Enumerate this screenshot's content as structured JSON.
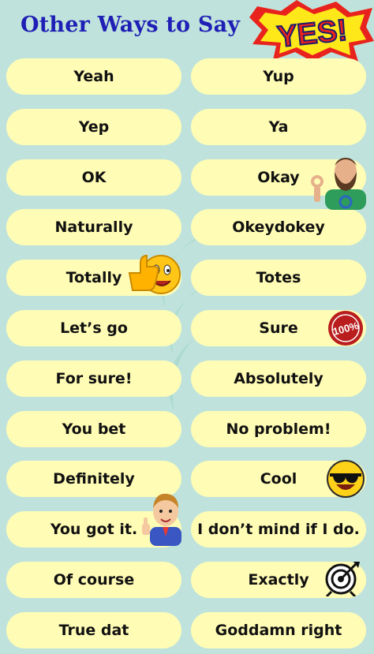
{
  "title": "Other Ways to Say",
  "badge": "YES!",
  "phrases": [
    [
      "Yeah",
      "Yup"
    ],
    [
      "Yep",
      "Ya"
    ],
    [
      "OK",
      "Okay"
    ],
    [
      "Naturally",
      "Okeydokey"
    ],
    [
      "Totally",
      "Totes"
    ],
    [
      "Let’s go",
      "Sure"
    ],
    [
      "For sure!",
      "Absolutely"
    ],
    [
      "You bet",
      "No problem!"
    ],
    [
      "Definitely",
      "Cool"
    ],
    [
      "You got it.",
      "I don’t mind if I do."
    ],
    [
      "Of course",
      "Exactly"
    ],
    [
      "True dat",
      "Goddamn right"
    ]
  ],
  "stamp_text": "100%",
  "icons": [
    "thumbs-up-emoji-icon",
    "bearded-man-ok-icon",
    "hundred-percent-stamp-icon",
    "sunglasses-emoji-icon",
    "thumbs-up-boy-icon",
    "target-icon"
  ],
  "colors": {
    "background": "#bfe3dc",
    "pill": "#fffcb5",
    "title": "#1f1fb5",
    "badge_yellow": "#ffe81a",
    "badge_red": "#e8231d"
  }
}
